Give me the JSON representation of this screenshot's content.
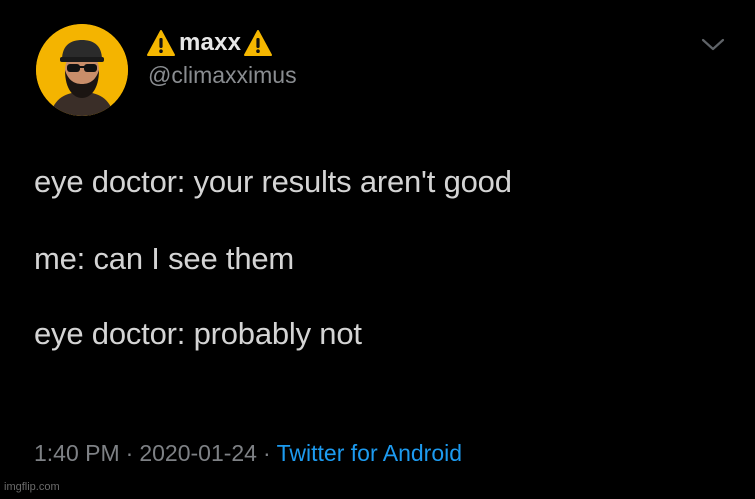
{
  "tweet": {
    "display_name": "maxx",
    "handle": "@climaxximus",
    "name_icon": "warning-icon",
    "lines": [
      "eye doctor: your results aren't good",
      "me: can I see them",
      "eye doctor: probably not"
    ],
    "time": "1:40 PM",
    "separator": "·",
    "date": "2020-01-24",
    "source": "Twitter for Android"
  },
  "watermark": "imgflip.com",
  "colors": {
    "background": "#000000",
    "avatar_bg": "#f4b400",
    "link": "#1d9bf0",
    "muted": "#7e8185"
  }
}
